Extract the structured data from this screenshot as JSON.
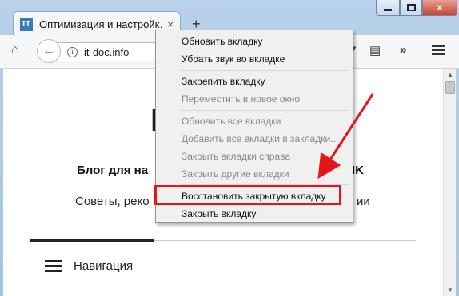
{
  "browser": {
    "tab": {
      "favicon_text": "IT",
      "title": "Оптимизация и настройк…",
      "close": "×"
    },
    "new_tab": "+",
    "window_controls": {
      "close": "×"
    },
    "url": "it-doc.info",
    "info_icon": "i",
    "back_icon": "←",
    "home_icon": "⌂",
    "reader_icon": "▤",
    "overflow_icon": "»",
    "dropdown_icon": "▾"
  },
  "page": {
    "logo_glyph": "I",
    "blog_title_start": "Блог для на",
    "blog_title_end": "IK",
    "blog_sub_start": "Советы, реко",
    "blog_sub_end": "ии",
    "nav_label": "Навигация"
  },
  "context_menu": {
    "items": [
      {
        "label": "Обновить вкладку",
        "disabled": false
      },
      {
        "label": "Убрать звук во вкладке",
        "disabled": false
      },
      {
        "label": "Закрепить вкладку",
        "disabled": false
      },
      {
        "label": "Переместить в новое окно",
        "disabled": true
      },
      {
        "label": "Обновить все вкладки",
        "disabled": true
      },
      {
        "label": "Добавить все вкладки в закладки...",
        "disabled": true
      },
      {
        "label": "Закрыть вкладки справа",
        "disabled": true
      },
      {
        "label": "Закрыть другие вкладки",
        "disabled": true
      },
      {
        "label": "Восстановить закрытую вкладку",
        "disabled": false
      },
      {
        "label": "Закрыть вкладку",
        "disabled": false
      }
    ]
  },
  "annotation": {
    "color": "#e3161c"
  }
}
